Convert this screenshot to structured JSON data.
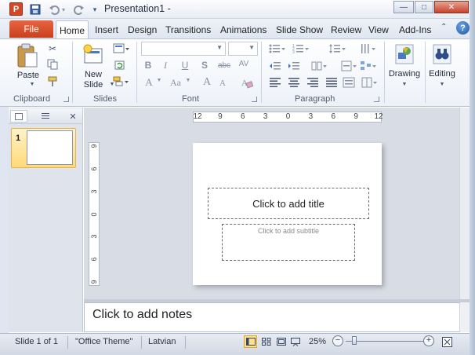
{
  "window": {
    "title": "Presentation1  -",
    "app_logo": "P",
    "quick_access": [
      "save-icon",
      "undo-icon",
      "undo-dropdown-icon",
      "redo-icon",
      "customize-qat-icon"
    ],
    "controls": {
      "minimize": "—",
      "maximize": "□",
      "close": "✕"
    }
  },
  "tabs": {
    "file": "File",
    "items": [
      "Home",
      "Insert",
      "Design",
      "Transitions",
      "Animations",
      "Slide Show",
      "Review",
      "View",
      "Add-Ins"
    ],
    "help": "?",
    "minimize_ribbon": "⌃"
  },
  "ribbon": {
    "clipboard": {
      "paste": "Paste",
      "label": "Clipboard"
    },
    "slides": {
      "new_slide_line1": "New",
      "new_slide_line2": "Slide",
      "label": "Slides"
    },
    "font": {
      "label": "Font",
      "bold": "B",
      "italic": "I",
      "underline": "U",
      "shadow": "S",
      "strike": "abc",
      "spacing": "AV",
      "font_color": "A",
      "change_case": "Aa",
      "grow": "A",
      "shrink": "A"
    },
    "paragraph": {
      "label": "Paragraph"
    },
    "drawing": {
      "label": "Drawing"
    },
    "editing": {
      "label": "Editing"
    }
  },
  "left_panel": {
    "slide_number": "1",
    "close": "✕"
  },
  "rulers": {
    "horizontal": [
      "12",
      "9",
      "6",
      "3",
      "0",
      "3",
      "6",
      "9",
      "12"
    ],
    "vertical": [
      "9",
      "6",
      "3",
      "0",
      "3",
      "6",
      "9"
    ]
  },
  "slide": {
    "title_placeholder": "Click to add title",
    "subtitle_placeholder": "Click to add subtitle"
  },
  "notes": {
    "placeholder": "Click to add notes"
  },
  "status": {
    "slide_info": "Slide 1 of 1",
    "theme": "\"Office Theme\"",
    "language": "Latvian",
    "zoom": "25%",
    "zoom_out": "−",
    "zoom_in": "+"
  },
  "colors": {
    "file_tab": "#d24726",
    "accent": "#2b579a",
    "selected_slide": "#ffd97a"
  }
}
